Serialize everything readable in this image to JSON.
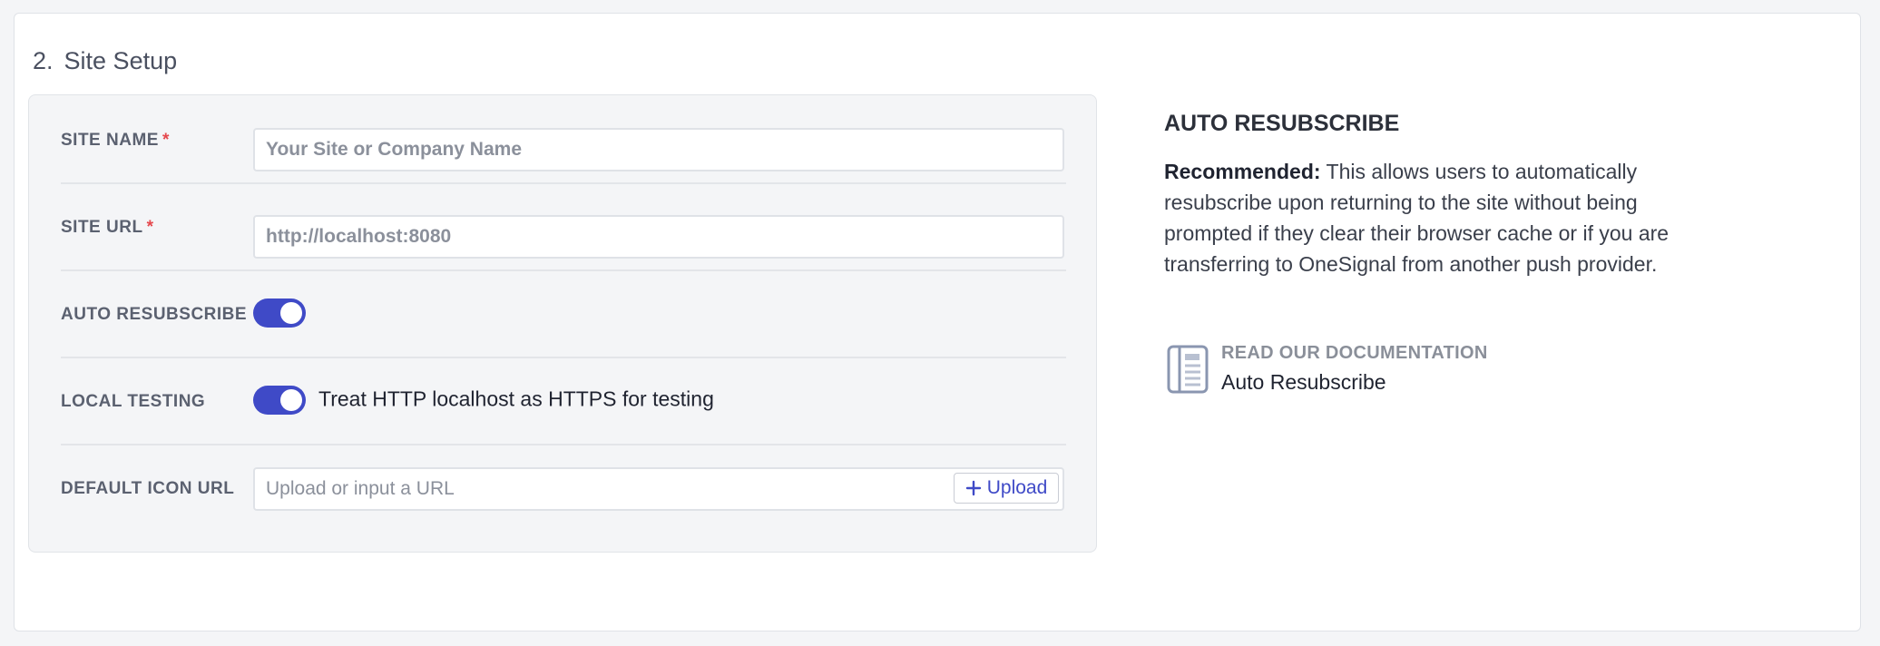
{
  "section": {
    "number": "2.",
    "title": "Site Setup"
  },
  "form": {
    "site_name": {
      "label": "SITE NAME",
      "required_mark": "*",
      "value": "",
      "placeholder": "Your Site or Company Name"
    },
    "site_url": {
      "label": "SITE URL",
      "required_mark": "*",
      "value": "",
      "placeholder": "http://localhost:8080"
    },
    "auto_resubscribe": {
      "label": "AUTO RESUBSCRIBE",
      "enabled": true
    },
    "local_testing": {
      "label": "LOCAL TESTING",
      "enabled": true,
      "text": "Treat HTTP localhost as HTTPS for testing"
    },
    "default_icon_url": {
      "label": "DEFAULT ICON URL",
      "value": "",
      "placeholder": "Upload or input a URL",
      "upload_label": "Upload"
    }
  },
  "help": {
    "title": "AUTO RESUBSCRIBE",
    "recommended_label": "Recommended:",
    "body": "This allows users to automatically resubscribe upon returning to the site without being prompted if they clear their browser cache or if you are transferring to OneSignal from another push provider.",
    "doc_link": {
      "label": "READ OUR DOCUMENTATION",
      "name": "Auto Resubscribe",
      "icon": "book-icon"
    }
  },
  "colors": {
    "accent": "#3f4ac7",
    "required": "#e5484d",
    "panel_bg": "#f4f5f7",
    "label": "#5b6170"
  }
}
